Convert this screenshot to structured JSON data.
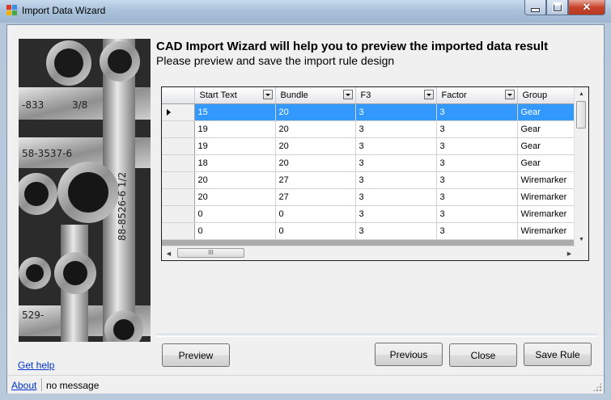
{
  "window": {
    "title": "Import Data Wizard",
    "close_glyph": "✕",
    "colors": {
      "title_gradient_top": "#c7d9ec",
      "close_red": "#c8432c",
      "selection": "#3399ff"
    }
  },
  "header": {
    "heading": "CAD Import Wizard will help you to preview the imported data result",
    "subheading": "Please preview and save the import rule design"
  },
  "grid": {
    "columns": [
      "Start Text",
      "Bundle",
      "F3",
      "Factor",
      "Group"
    ],
    "selected_row": 0,
    "rows": [
      [
        "15",
        "20",
        "3",
        "3",
        "Gear"
      ],
      [
        "19",
        "20",
        "3",
        "3",
        "Gear"
      ],
      [
        "19",
        "20",
        "3",
        "3",
        "Gear"
      ],
      [
        "18",
        "20",
        "3",
        "3",
        "Gear"
      ],
      [
        "20",
        "27",
        "3",
        "3",
        "Wiremarker"
      ],
      [
        "20",
        "27",
        "3",
        "3",
        "Wiremarker"
      ],
      [
        "0",
        "0",
        "3",
        "3",
        "Wiremarker"
      ],
      [
        "0",
        "0",
        "3",
        "3",
        "Wiremarker"
      ]
    ],
    "scroll": {
      "up": "▲",
      "down": "▼",
      "left": "◀",
      "right": "▶",
      "hthumb_grip": "III"
    }
  },
  "buttons": {
    "preview": "Preview",
    "previous": "Previous",
    "close": "Close",
    "save_rule": "Save Rule"
  },
  "links": {
    "help": "Get help",
    "about": "About"
  },
  "status": {
    "message": "no message"
  }
}
